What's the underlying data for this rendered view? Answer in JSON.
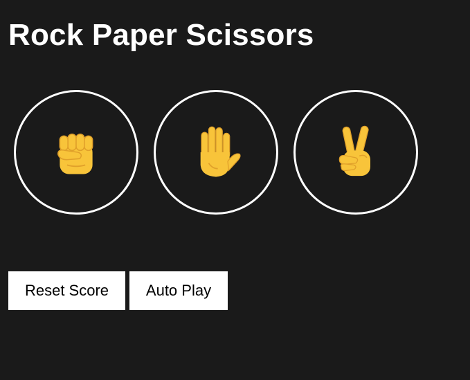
{
  "title": "Rock Paper Scissors",
  "moves": [
    {
      "name": "rock",
      "icon": "rock-fist-icon"
    },
    {
      "name": "paper",
      "icon": "paper-hand-icon"
    },
    {
      "name": "scissors",
      "icon": "scissors-victory-hand-icon"
    }
  ],
  "controls": {
    "reset_label": "Reset Score",
    "auto_play_label": "Auto Play"
  },
  "colors": {
    "background": "#1a1a1a",
    "foreground": "#ffffff",
    "emoji_yellow": "#f8c43a",
    "emoji_shadow": "#e0a02a"
  }
}
